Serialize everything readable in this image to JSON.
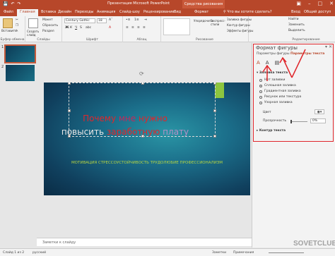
{
  "window": {
    "title": "Презентация Microsoft PowerPoint",
    "context_tab": "Средства рисования"
  },
  "tabs": [
    {
      "label": "Файл"
    },
    {
      "label": "Главная"
    },
    {
      "label": "Вставка"
    },
    {
      "label": "Дизайн"
    },
    {
      "label": "Переходы"
    },
    {
      "label": "Анимация"
    },
    {
      "label": "Слайд-шоу"
    },
    {
      "label": "Рецензирование"
    },
    {
      "label": "Вид"
    },
    {
      "label": "Формат"
    }
  ],
  "tell_me": "Что вы хотите сделать?",
  "signin": "Вход",
  "share": "Общий доступ",
  "ribbon": {
    "paste": "Вставить",
    "clipboard_group": "Буфер обмена",
    "slide_layout": "Макет",
    "slide_reset": "Сбросить",
    "slide_section": "Раздел",
    "slides_new": "Создать слайд",
    "slides_group": "Слайды",
    "font_name": "Century Gothic",
    "font_size": "18",
    "font_group": "Шрифт",
    "paragraph_group": "Абзац",
    "drawing_group": "Рисование",
    "arrange": "Упорядочить",
    "quick_styles": "Экспресс-стили",
    "fill": "Заливка фигуры",
    "outline": "Контур фигуры",
    "effects": "Эффекты фигуры",
    "find": "Найти",
    "replace": "Заменить",
    "select": "Выделить",
    "editing_group": "Редактирование"
  },
  "slides": [
    {
      "number": "1"
    },
    {
      "number": "2"
    }
  ],
  "slide": {
    "title_line1": [
      {
        "text": "Почему ",
        "color": "#e0262b"
      },
      {
        "text": "мне",
        "color": "#c02a5c"
      },
      {
        "text": " нужно",
        "color": "#e0262b"
      }
    ],
    "title_line2": [
      {
        "text": "повысить ",
        "color": "#e8e8e8"
      },
      {
        "text": "заработную",
        "color": "#e0262b"
      },
      {
        "text": " плату",
        "color": "#b38fc6"
      }
    ],
    "subtitle": "МОТИВАЦИЯ СТРЕССОУСТОЙЧИВОСТЬ ТРУДОЛЮБИЕ ПРОФЕССИОНАЛИЗМ",
    "accent_color": "#8dc63f"
  },
  "notes_placeholder": "Заметки к слайду",
  "format_pane": {
    "title": "Формат фигуры",
    "tab_shape": "Параметры фигуры",
    "tab_text": "Параметры текста",
    "fill_section": "Заливка текста",
    "options": [
      {
        "label": "Нет заливки",
        "selected": false
      },
      {
        "label": "Сплошная заливка",
        "selected": true
      },
      {
        "label": "Градиентная заливка",
        "selected": false
      },
      {
        "label": "Рисунок или текстура",
        "selected": false
      },
      {
        "label": "Узорная заливка",
        "selected": false
      }
    ],
    "color_label": "Цвет",
    "transparency_label": "Прозрачность",
    "transparency_value": "0%",
    "outline_section": "Контур текста"
  },
  "status": {
    "slide_info": "Слайд 1 из 2",
    "language": "русский",
    "notes_btn": "Заметки",
    "comments_btn": "Примечания"
  },
  "watermark": "SOVETCLUB",
  "highlight_color": "#e0262b"
}
